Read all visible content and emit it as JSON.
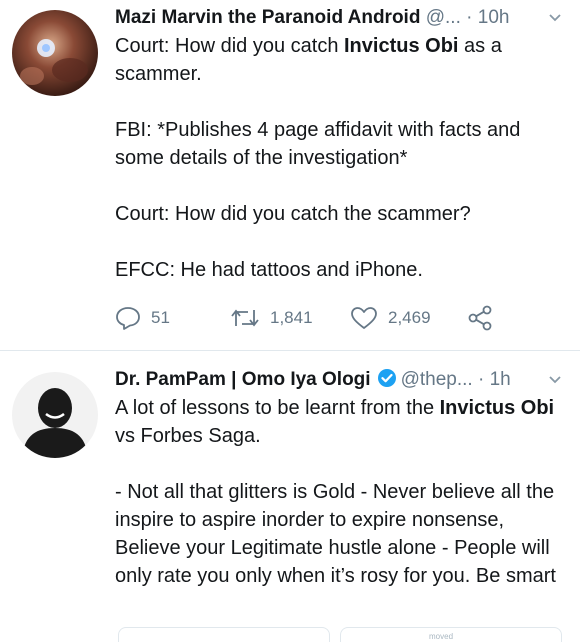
{
  "tweets": [
    {
      "name": "Mazi Marvin the Paranoid Android",
      "handle": "@...",
      "dot": "·",
      "time": "10h",
      "line1_pre": "Court: How did you catch ",
      "line1_bold": "Invictus Obi",
      "line1_post": " as a scammer.",
      "p2": "FBI: *Publishes 4 page affidavit with facts and some details of the investigation*",
      "p3": "Court: How did you catch the scammer?",
      "p4": "EFCC: He had tattoos and iPhone.",
      "replies": "51",
      "retweets": "1,841",
      "likes": "2,469"
    },
    {
      "name": "Dr. PamPam | Omo Iya Ologi",
      "handle": "@thep...",
      "dot": "·",
      "time": "1h",
      "line1_pre": "A lot of lessons to be learnt from the ",
      "line1_bold": "Invictus Obi",
      "line1_post": " vs Forbes Saga.",
      "p2": "- Not all that glitters is Gold - Never believe all the inspire to aspire inorder to expire nonsense, Believe your Legitimate hustle alone - People will only rate you only when it’s rosy for you. Be smart"
    }
  ],
  "footer_hint": "moved",
  "colors": {
    "verified": "#1da1f2",
    "muted": "#657786",
    "divider": "#e1e8ed"
  }
}
